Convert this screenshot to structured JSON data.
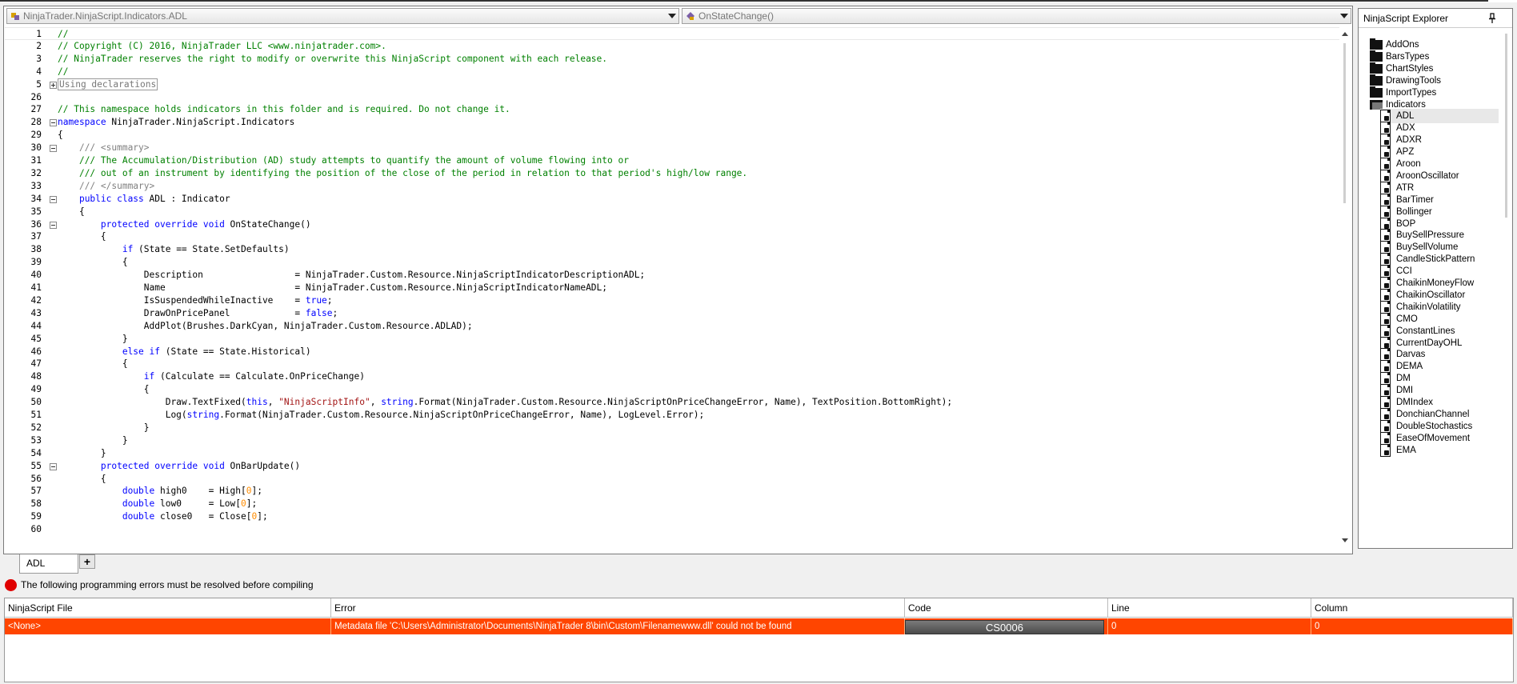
{
  "editor": {
    "file_combo": "NinjaTrader.NinjaScript.Indicators.ADL",
    "method_combo": "OnStateChange()",
    "lines": [
      {
        "n": "1",
        "fold": "",
        "segs": [
          [
            "cm",
            "//"
          ]
        ]
      },
      {
        "n": "2",
        "fold": "",
        "segs": [
          [
            "cm",
            "// Copyright (C) 2016, NinjaTrader LLC <www.ninjatrader.com>."
          ]
        ]
      },
      {
        "n": "3",
        "fold": "",
        "segs": [
          [
            "cm",
            "// NinjaTrader reserves the right to modify or overwrite this NinjaScript component with each release."
          ]
        ]
      },
      {
        "n": "4",
        "fold": "",
        "segs": [
          [
            "cm",
            "//"
          ]
        ]
      },
      {
        "n": "5",
        "fold": "plus",
        "segs": [
          [
            "collapsed",
            "Using declarations"
          ]
        ]
      },
      {
        "n": "26",
        "fold": "",
        "segs": []
      },
      {
        "n": "27",
        "fold": "",
        "segs": [
          [
            "cm",
            "// This namespace holds indicators in this folder and is required. Do not change it."
          ]
        ]
      },
      {
        "n": "28",
        "fold": "minus",
        "segs": [
          [
            "kw",
            "namespace"
          ],
          [
            "",
            " NinjaTrader.NinjaScript.Indicators"
          ]
        ]
      },
      {
        "n": "29",
        "fold": "",
        "segs": [
          [
            "",
            "{"
          ]
        ]
      },
      {
        "n": "30",
        "fold": "minus",
        "segs": [
          [
            "",
            "    "
          ],
          [
            "xd",
            "/// <summary>"
          ]
        ]
      },
      {
        "n": "31",
        "fold": "",
        "segs": [
          [
            "",
            "    "
          ],
          [
            "cm",
            "/// The Accumulation/Distribution (AD) study attempts to quantify the amount of volume flowing into or"
          ]
        ]
      },
      {
        "n": "32",
        "fold": "",
        "segs": [
          [
            "",
            "    "
          ],
          [
            "cm",
            "/// out of an instrument by identifying the position of the close of the period in relation to that period's high/low range."
          ]
        ]
      },
      {
        "n": "33",
        "fold": "",
        "segs": [
          [
            "",
            "    "
          ],
          [
            "xd",
            "/// </summary>"
          ]
        ]
      },
      {
        "n": "34",
        "fold": "minus",
        "segs": [
          [
            "",
            "    "
          ],
          [
            "kw",
            "public class"
          ],
          [
            "",
            " ADL : Indicator"
          ]
        ]
      },
      {
        "n": "35",
        "fold": "",
        "segs": [
          [
            "",
            "    {"
          ]
        ]
      },
      {
        "n": "36",
        "fold": "minus",
        "segs": [
          [
            "",
            "        "
          ],
          [
            "kw",
            "protected override void"
          ],
          [
            "",
            " OnStateChange()"
          ]
        ]
      },
      {
        "n": "37",
        "fold": "",
        "segs": [
          [
            "",
            "        {"
          ]
        ]
      },
      {
        "n": "38",
        "fold": "",
        "segs": [
          [
            "",
            "            "
          ],
          [
            "kw",
            "if"
          ],
          [
            "",
            " (State == State.SetDefaults)"
          ]
        ]
      },
      {
        "n": "39",
        "fold": "",
        "segs": [
          [
            "",
            "            {"
          ]
        ]
      },
      {
        "n": "40",
        "fold": "",
        "segs": [
          [
            "",
            "                Description                 = NinjaTrader.Custom.Resource.NinjaScriptIndicatorDescriptionADL;"
          ]
        ]
      },
      {
        "n": "41",
        "fold": "",
        "segs": [
          [
            "",
            "                Name                        = NinjaTrader.Custom.Resource.NinjaScriptIndicatorNameADL;"
          ]
        ]
      },
      {
        "n": "42",
        "fold": "",
        "segs": [
          [
            "",
            "                IsSuspendedWhileInactive    = "
          ],
          [
            "kw",
            "true"
          ],
          [
            "",
            ";"
          ]
        ]
      },
      {
        "n": "43",
        "fold": "",
        "segs": [
          [
            "",
            "                DrawOnPricePanel            = "
          ],
          [
            "kw",
            "false"
          ],
          [
            "",
            ";"
          ]
        ]
      },
      {
        "n": "44",
        "fold": "",
        "segs": [
          [
            "",
            "                AddPlot(Brushes.DarkCyan, NinjaTrader.Custom.Resource.ADLAD);"
          ]
        ]
      },
      {
        "n": "45",
        "fold": "",
        "segs": [
          [
            "",
            "            }"
          ]
        ]
      },
      {
        "n": "46",
        "fold": "",
        "segs": [
          [
            "",
            "            "
          ],
          [
            "kw",
            "else if"
          ],
          [
            "",
            " (State == State.Historical)"
          ]
        ]
      },
      {
        "n": "47",
        "fold": "",
        "segs": [
          [
            "",
            "            {"
          ]
        ]
      },
      {
        "n": "48",
        "fold": "",
        "segs": [
          [
            "",
            "                "
          ],
          [
            "kw",
            "if"
          ],
          [
            "",
            " (Calculate == Calculate.OnPriceChange)"
          ]
        ]
      },
      {
        "n": "49",
        "fold": "",
        "segs": [
          [
            "",
            "                {"
          ]
        ]
      },
      {
        "n": "50",
        "fold": "",
        "segs": [
          [
            "",
            "                    Draw.TextFixed("
          ],
          [
            "kw",
            "this"
          ],
          [
            "",
            ", "
          ],
          [
            "st",
            "\"NinjaScriptInfo\""
          ],
          [
            "",
            ", "
          ],
          [
            "kw",
            "string"
          ],
          [
            "",
            ".Format(NinjaTrader.Custom.Resource.NinjaScriptOnPriceChangeError, Name), TextPosition.BottomRight);"
          ]
        ]
      },
      {
        "n": "51",
        "fold": "",
        "segs": [
          [
            "",
            "                    Log("
          ],
          [
            "kw",
            "string"
          ],
          [
            "",
            ".Format(NinjaTrader.Custom.Resource.NinjaScriptOnPriceChangeError, Name), LogLevel.Error);"
          ]
        ]
      },
      {
        "n": "52",
        "fold": "",
        "segs": [
          [
            "",
            "                }"
          ]
        ]
      },
      {
        "n": "53",
        "fold": "",
        "segs": [
          [
            "",
            "            }"
          ]
        ]
      },
      {
        "n": "54",
        "fold": "",
        "segs": [
          [
            "",
            "        }"
          ]
        ]
      },
      {
        "n": "55",
        "fold": "minus",
        "segs": [
          [
            "",
            "        "
          ],
          [
            "kw",
            "protected override void"
          ],
          [
            "",
            " OnBarUpdate()"
          ]
        ]
      },
      {
        "n": "56",
        "fold": "",
        "segs": [
          [
            "",
            "        {"
          ]
        ]
      },
      {
        "n": "57",
        "fold": "",
        "segs": [
          [
            "",
            "            "
          ],
          [
            "kw",
            "double"
          ],
          [
            "",
            " high0    = High["
          ],
          [
            "nm",
            "0"
          ],
          [
            "",
            "];"
          ]
        ]
      },
      {
        "n": "58",
        "fold": "",
        "segs": [
          [
            "",
            "            "
          ],
          [
            "kw",
            "double"
          ],
          [
            "",
            " low0     = Low["
          ],
          [
            "nm",
            "0"
          ],
          [
            "",
            "];"
          ]
        ]
      },
      {
        "n": "59",
        "fold": "",
        "segs": [
          [
            "",
            "            "
          ],
          [
            "kw",
            "double"
          ],
          [
            "",
            " close0   = Close["
          ],
          [
            "nm",
            "0"
          ],
          [
            "",
            "];"
          ]
        ]
      },
      {
        "n": "60",
        "fold": "",
        "segs": []
      }
    ]
  },
  "tabs": {
    "active": "ADL",
    "add_label": "+"
  },
  "explorer": {
    "title": "NinjaScript Explorer",
    "folders": [
      "AddOns",
      "BarsTypes",
      "ChartStyles",
      "DrawingTools",
      "ImportTypes"
    ],
    "open_folder": "Indicators",
    "files": [
      "ADL",
      "ADX",
      "ADXR",
      "APZ",
      "Aroon",
      "AroonOscillator",
      "ATR",
      "BarTimer",
      "Bollinger",
      "BOP",
      "BuySellPressure",
      "BuySellVolume",
      "CandleStickPattern",
      "CCI",
      "ChaikinMoneyFlow",
      "ChaikinOscillator",
      "ChaikinVolatility",
      "CMO",
      "ConstantLines",
      "CurrentDayOHL",
      "Darvas",
      "DEMA",
      "DM",
      "DMI",
      "DMIndex",
      "DonchianChannel",
      "DoubleStochastics",
      "EaseOfMovement",
      "EMA"
    ],
    "selected_file": "ADL"
  },
  "errors": {
    "message": "The following programming errors must be resolved before compiling",
    "columns": [
      "NinjaScript File",
      "Error",
      "Code",
      "Line",
      "Column"
    ],
    "rows": [
      {
        "file": "<None>",
        "error": "Metadata file 'C:\\Users\\Administrator\\Documents\\NinjaTrader 8\\bin\\Custom\\Filenamewww.dll' could not be found",
        "code": "CS0006",
        "line": "0",
        "column": "0"
      }
    ],
    "row_color": "#ff4500"
  }
}
